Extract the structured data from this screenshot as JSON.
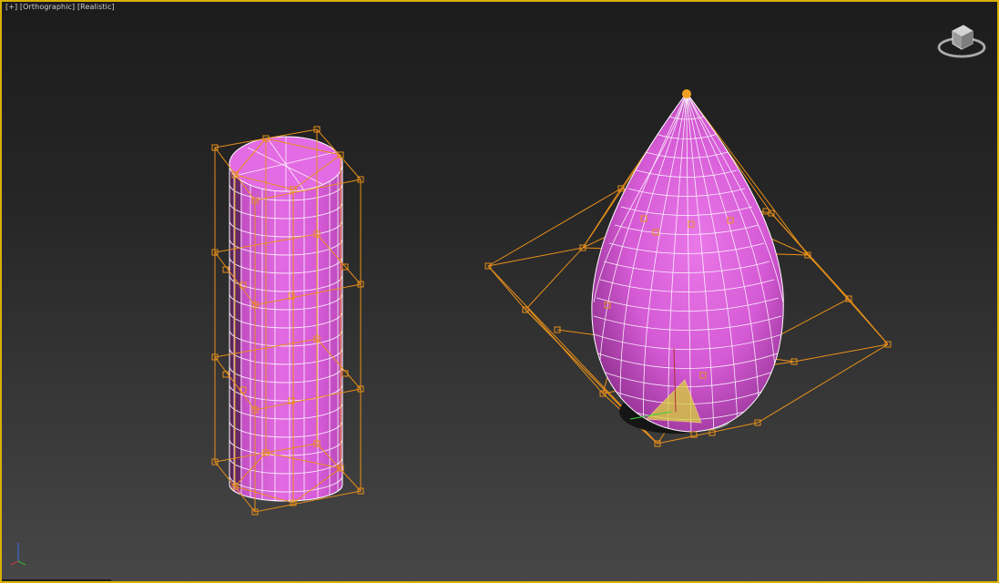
{
  "viewport": {
    "label_plus": "[+]",
    "label_view": "[Orthographic]",
    "label_shading": "[Realistic]",
    "active_border_color": "#d7b000"
  },
  "scene": {
    "object_color": "#d85ad8",
    "wire_color": "#ffffff",
    "lattice_color": "#e8901a",
    "objects": [
      {
        "name": "cylinder",
        "modifier": "FFD lattice"
      },
      {
        "name": "teardrop",
        "modifier": "FFD lattice"
      }
    ]
  },
  "icons": {
    "viewcube": "viewcube-icon",
    "axis": "axis-tripod-icon"
  }
}
